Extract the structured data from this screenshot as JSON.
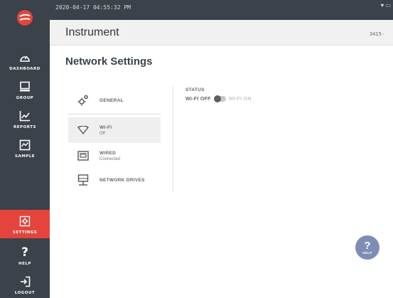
{
  "topbar": {
    "datetime": "2020-04-17 04:55:32 PM",
    "status_icons": "♥ ▭"
  },
  "header": {
    "title": "Instrument",
    "serial": "3415-"
  },
  "sidebar": {
    "items": [
      {
        "label": "DASHBOARD",
        "icon": "gauge-icon"
      },
      {
        "label": "GROUP",
        "icon": "monitor-icon"
      },
      {
        "label": "REPORTS",
        "icon": "line-chart-icon"
      },
      {
        "label": "SAMPLE",
        "icon": "sample-chart-icon"
      },
      {
        "label": "SETTINGS",
        "icon": "gear-icon",
        "active": true
      },
      {
        "label": "HELP",
        "icon": "question-icon"
      },
      {
        "label": "LOGOUT",
        "icon": "logout-icon"
      }
    ]
  },
  "page": {
    "title": "Network Settings"
  },
  "settings_menu": {
    "general": {
      "label": "GENERAL"
    },
    "wifi": {
      "label": "WI-FI",
      "sub": "Off"
    },
    "wired": {
      "label": "WIRED",
      "sub": "Connected"
    },
    "network_drives": {
      "label": "NETWORK DRIVES"
    }
  },
  "status": {
    "label": "STATUS",
    "wifi_off": "WI-FI OFF",
    "wifi_on": "WI-FI ON",
    "wifi_enabled": false
  },
  "help_fab": {
    "symbol": "?",
    "label": "HELP"
  },
  "colors": {
    "sidebar": "#3b4249",
    "accent": "#e5443d",
    "help_fab": "#7f8cb6"
  }
}
